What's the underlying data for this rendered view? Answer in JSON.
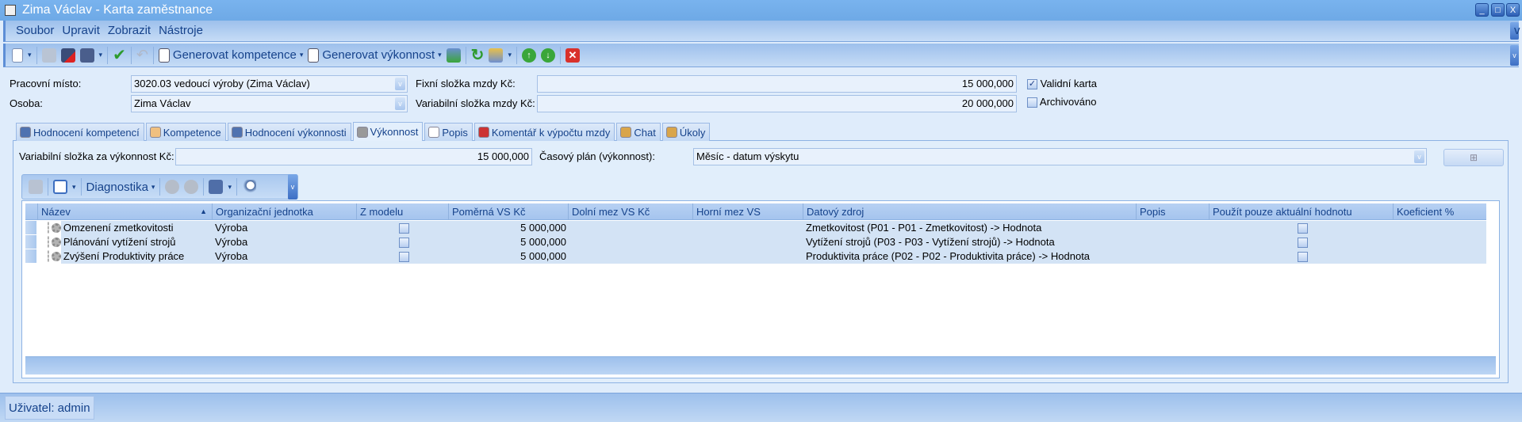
{
  "window": {
    "title": "Zima Václav - Karta zaměstnance",
    "minimize": "_",
    "maximize": "□",
    "close": "X"
  },
  "menu": [
    "Soubor",
    "Upravit",
    "Zobrazit",
    "Nástroje"
  ],
  "toolbar": {
    "generate_competence": "Generovat kompetence",
    "generate_performance": "Generovat výkonnost"
  },
  "form": {
    "work_position_label": "Pracovní místo:",
    "work_position_value": "3020.03 vedoucí výroby (Zima Václav)",
    "person_label": "Osoba:",
    "person_value": "Zima Václav",
    "fixed_wage_label": "Fixní složka mzdy Kč:",
    "fixed_wage_value": "15 000,000",
    "variable_wage_label": "Variabilní složka mzdy Kč:",
    "variable_wage_value": "20 000,000",
    "valid_card_label": "Validní karta",
    "valid_card_checked": true,
    "archived_label": "Archivováno",
    "archived_checked": false
  },
  "tabs": [
    {
      "label": "Hodnocení kompetencí",
      "icon": "evaluation-icon"
    },
    {
      "label": "Kompetence",
      "icon": "hand-icon"
    },
    {
      "label": "Hodnocení výkonnosti",
      "icon": "evaluation-icon"
    },
    {
      "label": "Výkonnost",
      "icon": "gear-icon",
      "active": true
    },
    {
      "label": "Popis",
      "icon": "document-icon"
    },
    {
      "label": "Komentář k výpočtu mzdy",
      "icon": "chart-icon"
    },
    {
      "label": "Chat",
      "icon": "note-icon"
    },
    {
      "label": "Úkoly",
      "icon": "note-icon"
    }
  ],
  "performance": {
    "variable_label": "Variabilní složka za výkonnost Kč:",
    "variable_value": "15 000,000",
    "plan_label": "Časový plán (výkonnost):",
    "plan_value": "Měsíc - datum výskytu"
  },
  "grid_toolbar": {
    "diagnostics": "Diagnostika"
  },
  "grid": {
    "columns": [
      "Název",
      "Organizační jednotka",
      "Z modelu",
      "Poměrná VS Kč",
      "Dolní mez VS Kč",
      "Horní mez VS",
      "Datový zdroj",
      "Popis",
      "Použít pouze aktuální hodnotu",
      "Koeficient %"
    ],
    "sort_column": "Název",
    "sort_dir": "ascending",
    "rows": [
      {
        "name": "Omzenení zmetkovitosti",
        "unit": "Výroba",
        "from_model": false,
        "proportional": "5 000,000",
        "lower": "",
        "upper": "",
        "source": "Zmetkovitost (P01 - P01 - Zmetkovitost) -> Hodnota",
        "description": "",
        "current_only": false,
        "coef": ""
      },
      {
        "name": "Plánování vytížení strojů",
        "unit": "Výroba",
        "from_model": false,
        "proportional": "5 000,000",
        "lower": "",
        "upper": "",
        "source": "Vytížení strojů (P03 - P03 - Vytížení strojů) -> Hodnota",
        "description": "",
        "current_only": false,
        "coef": ""
      },
      {
        "name": "Zvýšení Produktivity práce",
        "unit": "Výroba",
        "from_model": false,
        "proportional": "5 000,000",
        "lower": "",
        "upper": "",
        "source": "Produktivita práce (P02 - P02 - Produktivita práce) -> Hodnota",
        "description": "",
        "current_only": false,
        "coef": ""
      }
    ]
  },
  "status": {
    "user": "Uživatel: admin"
  },
  "colors": {
    "title": "#6ea9e6",
    "panel": "#e1eefb",
    "header_text": "#15428b",
    "row": "#d3e3f5"
  }
}
